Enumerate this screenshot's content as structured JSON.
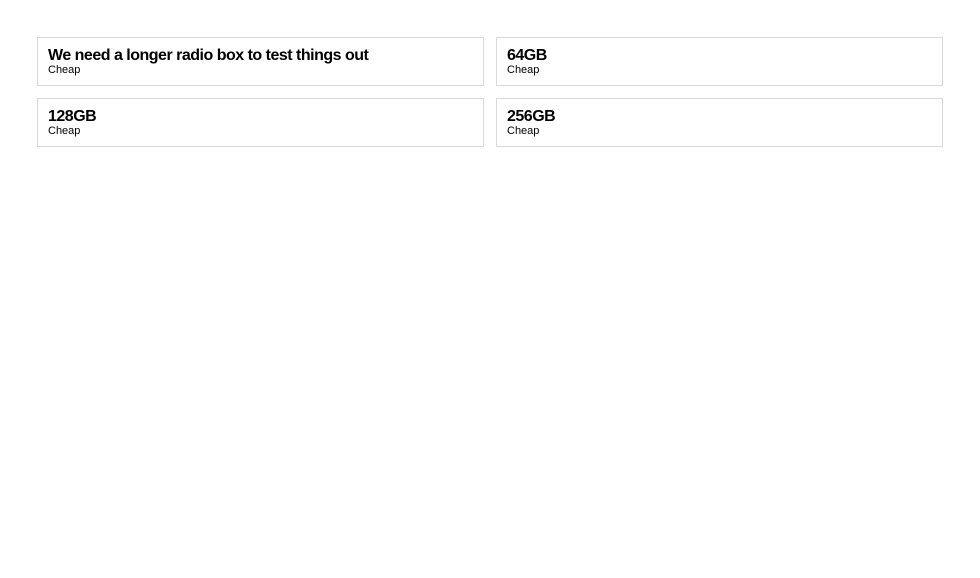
{
  "radio_boxes": [
    {
      "title": "We need a longer radio box to test things out",
      "subtitle": "Cheap"
    },
    {
      "title": "64GB",
      "subtitle": "Cheap"
    },
    {
      "title": "128GB",
      "subtitle": "Cheap"
    },
    {
      "title": "256GB",
      "subtitle": "Cheap"
    }
  ],
  "colors": {
    "border": "#d8dada",
    "text": "#000000",
    "background": "#ffffff"
  }
}
